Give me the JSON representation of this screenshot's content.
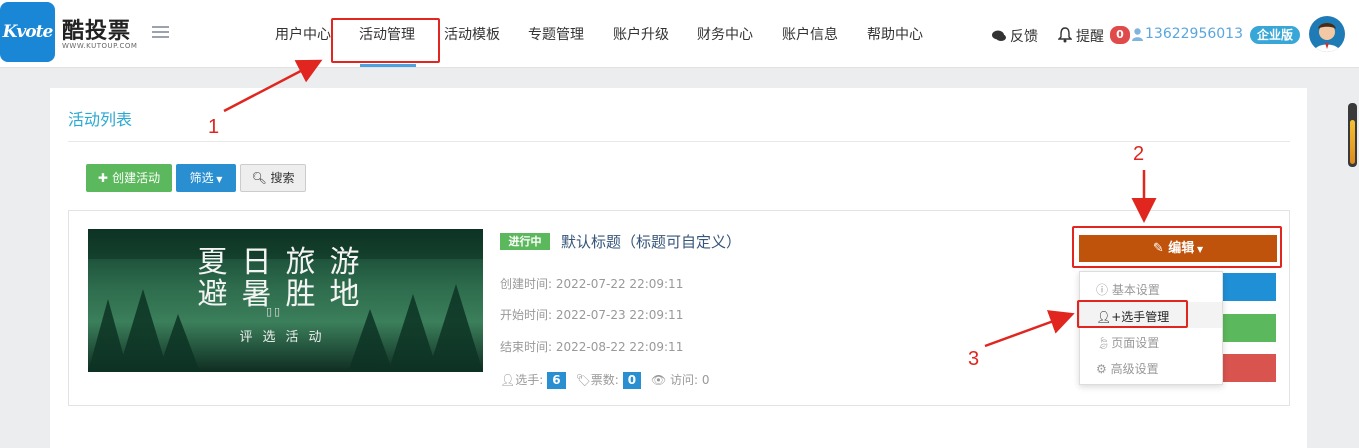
{
  "brand": {
    "logo_text": "Kvote",
    "name": "酷投票",
    "url": "WWW.KUTOUP.COM"
  },
  "nav": {
    "items": [
      "用户中心",
      "活动管理",
      "活动模板",
      "专题管理",
      "账户升级",
      "财务中心",
      "账户信息",
      "帮助中心"
    ],
    "active": "活动管理"
  },
  "toolbar": {
    "feedback": "反馈",
    "remind": "提醒",
    "remind_count": "0",
    "phone": "13622956013",
    "edition": "企业版"
  },
  "panel": {
    "title": "活动列表"
  },
  "actions": {
    "create": "创建活动",
    "filter": "筛选",
    "search": "搜索"
  },
  "activity": {
    "image_title_line1": "夏日旅游",
    "image_title_line2": "避暑胜地",
    "image_subtitle": "评选活动",
    "status": "进行中",
    "title": "默认标题（标题可自定义）",
    "created_label": "创建时间:",
    "created": "2022-07-22 22:09:11",
    "start_label": "开始时间:",
    "start": "2022-07-23 22:09:11",
    "end_label": "结束时间:",
    "end": "2022-08-22 22:09:11",
    "players_label": "选手:",
    "players": "6",
    "votes_label": "票数:",
    "votes": "0",
    "visits_label": "访问:",
    "visits": "0"
  },
  "edit_menu": {
    "button": "编辑",
    "items": [
      "基本设置",
      "选手管理",
      "页面设置",
      "高级设置"
    ],
    "side_button_colors": [
      "#1f8fd6",
      "#5cb85c",
      "#d9534f"
    ]
  },
  "annotations": {
    "labels": [
      "1",
      "2",
      "3"
    ],
    "color": "#e0261f"
  },
  "colors": {
    "accent": "#29a9d1",
    "edit": "#c0530c",
    "success": "#5cb85c",
    "primary": "#2a8fd1"
  }
}
